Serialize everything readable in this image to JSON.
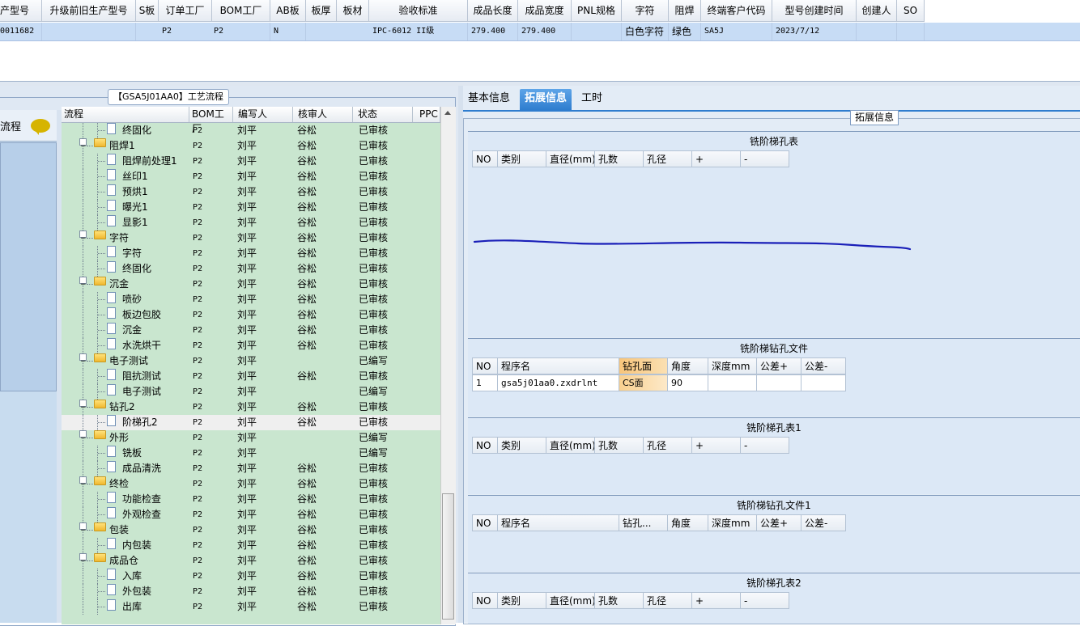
{
  "top_grid": {
    "headers": [
      "产型号",
      "升级前旧生产型号",
      "S板",
      "订单工厂",
      "BOM工厂",
      "AB板",
      "板厚",
      "板材",
      "验收标准",
      "成品长度",
      "成品宽度",
      "PNL规格",
      "字符",
      "阻焊",
      "终端客户代码",
      "型号创建时间",
      "创建人",
      "SO"
    ],
    "row": {
      "model": "0011682",
      "s_board": "P2",
      "order_factory": "P2",
      "ab_board": "N",
      "standard": "IPC-6012 II级",
      "length": "279.400",
      "width": "279.400",
      "char": "白色字符",
      "mask": "绿色",
      "customer_code": "SA5J",
      "created": "2023/7/12"
    }
  },
  "process_panel": {
    "title": "【GSA5J01AA0】工艺流程",
    "side_label": "流程",
    "columns": [
      "流程",
      "BOM工厂",
      "编写人",
      "核审人",
      "状态",
      "PPC"
    ],
    "rows": [
      {
        "name": "终固化",
        "bom": "P2",
        "writer": "刘平",
        "reviewer": "谷松",
        "status": "已审核",
        "level": 2
      },
      {
        "name": "阻焊1",
        "bom": "P2",
        "writer": "刘平",
        "reviewer": "谷松",
        "status": "已审核",
        "level": 1
      },
      {
        "name": "阻焊前处理1",
        "bom": "P2",
        "writer": "刘平",
        "reviewer": "谷松",
        "status": "已审核",
        "level": 2
      },
      {
        "name": "丝印1",
        "bom": "P2",
        "writer": "刘平",
        "reviewer": "谷松",
        "status": "已审核",
        "level": 2
      },
      {
        "name": "预烘1",
        "bom": "P2",
        "writer": "刘平",
        "reviewer": "谷松",
        "status": "已审核",
        "level": 2
      },
      {
        "name": "曝光1",
        "bom": "P2",
        "writer": "刘平",
        "reviewer": "谷松",
        "status": "已审核",
        "level": 2
      },
      {
        "name": "显影1",
        "bom": "P2",
        "writer": "刘平",
        "reviewer": "谷松",
        "status": "已审核",
        "level": 2
      },
      {
        "name": "字符",
        "bom": "P2",
        "writer": "刘平",
        "reviewer": "谷松",
        "status": "已审核",
        "level": 1
      },
      {
        "name": "字符",
        "bom": "P2",
        "writer": "刘平",
        "reviewer": "谷松",
        "status": "已审核",
        "level": 2
      },
      {
        "name": "终固化",
        "bom": "P2",
        "writer": "刘平",
        "reviewer": "谷松",
        "status": "已审核",
        "level": 2
      },
      {
        "name": "沉金",
        "bom": "P2",
        "writer": "刘平",
        "reviewer": "谷松",
        "status": "已审核",
        "level": 1
      },
      {
        "name": "喷砂",
        "bom": "P2",
        "writer": "刘平",
        "reviewer": "谷松",
        "status": "已审核",
        "level": 2
      },
      {
        "name": "板边包胶",
        "bom": "P2",
        "writer": "刘平",
        "reviewer": "谷松",
        "status": "已审核",
        "level": 2
      },
      {
        "name": "沉金",
        "bom": "P2",
        "writer": "刘平",
        "reviewer": "谷松",
        "status": "已审核",
        "level": 2
      },
      {
        "name": "水洗烘干",
        "bom": "P2",
        "writer": "刘平",
        "reviewer": "谷松",
        "status": "已审核",
        "level": 2
      },
      {
        "name": "电子测试",
        "bom": "P2",
        "writer": "刘平",
        "reviewer": "",
        "status": "已编写",
        "level": 1
      },
      {
        "name": "阻抗测试",
        "bom": "P2",
        "writer": "刘平",
        "reviewer": "谷松",
        "status": "已审核",
        "level": 2
      },
      {
        "name": "电子测试",
        "bom": "P2",
        "writer": "刘平",
        "reviewer": "",
        "status": "已编写",
        "level": 2
      },
      {
        "name": "钻孔2",
        "bom": "P2",
        "writer": "刘平",
        "reviewer": "谷松",
        "status": "已审核",
        "level": 1
      },
      {
        "name": "阶梯孔2",
        "bom": "P2",
        "writer": "刘平",
        "reviewer": "谷松",
        "status": "已审核",
        "level": 2,
        "selected": true
      },
      {
        "name": "外形",
        "bom": "P2",
        "writer": "刘平",
        "reviewer": "",
        "status": "已编写",
        "level": 1
      },
      {
        "name": "铣板",
        "bom": "P2",
        "writer": "刘平",
        "reviewer": "",
        "status": "已编写",
        "level": 2
      },
      {
        "name": "成品清洗",
        "bom": "P2",
        "writer": "刘平",
        "reviewer": "谷松",
        "status": "已审核",
        "level": 2
      },
      {
        "name": "终检",
        "bom": "P2",
        "writer": "刘平",
        "reviewer": "谷松",
        "status": "已审核",
        "level": 1
      },
      {
        "name": "功能检查",
        "bom": "P2",
        "writer": "刘平",
        "reviewer": "谷松",
        "status": "已审核",
        "level": 2
      },
      {
        "name": "外观检查",
        "bom": "P2",
        "writer": "刘平",
        "reviewer": "谷松",
        "status": "已审核",
        "level": 2
      },
      {
        "name": "包装",
        "bom": "P2",
        "writer": "刘平",
        "reviewer": "谷松",
        "status": "已审核",
        "level": 1
      },
      {
        "name": "内包装",
        "bom": "P2",
        "writer": "刘平",
        "reviewer": "谷松",
        "status": "已审核",
        "level": 2
      },
      {
        "name": "成品仓",
        "bom": "P2",
        "writer": "刘平",
        "reviewer": "谷松",
        "status": "已审核",
        "level": 1
      },
      {
        "name": "入库",
        "bom": "P2",
        "writer": "刘平",
        "reviewer": "谷松",
        "status": "已审核",
        "level": 2
      },
      {
        "name": "外包装",
        "bom": "P2",
        "writer": "刘平",
        "reviewer": "谷松",
        "status": "已审核",
        "level": 2
      },
      {
        "name": "出库",
        "bom": "P2",
        "writer": "刘平",
        "reviewer": "谷松",
        "status": "已审核",
        "level": 2
      }
    ]
  },
  "right_panel": {
    "tabs": [
      "基本信息",
      "拓展信息",
      "工时"
    ],
    "active_tab": 1,
    "group_title": "拓展信息",
    "hole_cols": [
      "NO",
      "类别",
      "直径(mm)",
      "孔数",
      "孔径",
      "+",
      "-"
    ],
    "file_cols": [
      "NO",
      "程序名",
      "钻孔面",
      "角度",
      "深度mm",
      "公差+",
      "公差-"
    ],
    "file_cols_trunc": [
      "NO",
      "程序名",
      "钻孔...",
      "角度",
      "深度mm",
      "公差+",
      "公差-"
    ],
    "sections": {
      "s1": {
        "title": "铣阶梯孔表"
      },
      "s2": {
        "title": "铣阶梯钻孔文件",
        "row": [
          "1",
          "gsa5j01aa0.zxdrlnt",
          "CS面",
          "90",
          "",
          "",
          ""
        ]
      },
      "s3": {
        "title": "铣阶梯孔表1"
      },
      "s4": {
        "title": "铣阶梯钻孔文件1"
      },
      "s5": {
        "title": "铣阶梯孔表2"
      }
    }
  },
  "colors": {
    "accent": "#2e7dcf",
    "tree_bg": "#c9e6cf",
    "selected_row": "#c7dcf5",
    "ink": "#1a1fb8"
  }
}
